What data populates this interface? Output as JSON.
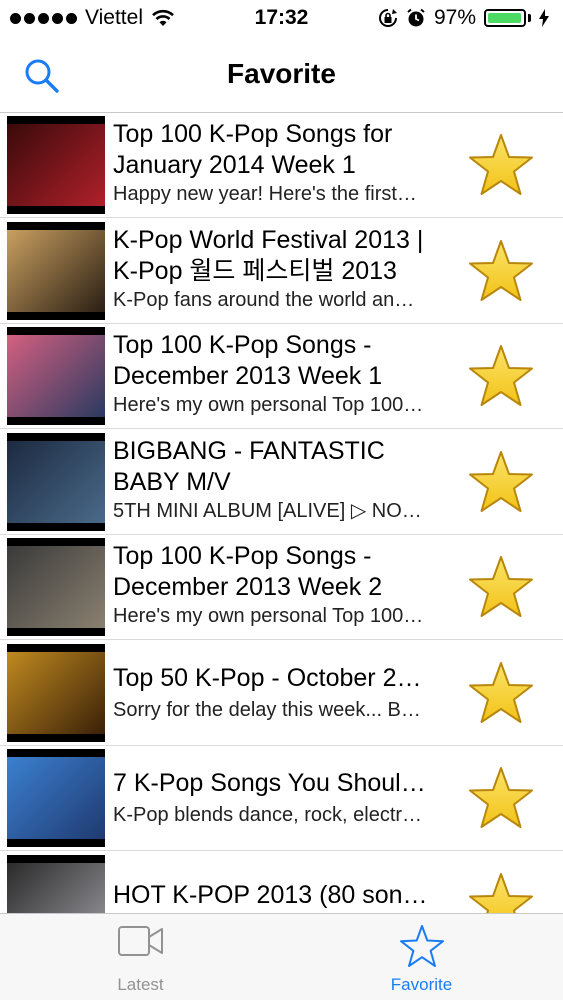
{
  "status": {
    "carrier": "Viettel",
    "time": "17:32",
    "battery": "97%",
    "battery_level": 0.97
  },
  "nav": {
    "title": "Favorite",
    "search_icon": "search-icon"
  },
  "colors": {
    "accent": "#1a7cf5",
    "inactive": "#929292",
    "battery": "#4cd964",
    "star_fill": "#f2c316",
    "star_stroke": "#b8860b"
  },
  "items": [
    {
      "title": "Top 100 K-Pop Songs for\nJanuary 2014 Week 1",
      "subtitle": "Happy new year! Here's the first…",
      "thumb_colors": [
        "#3a0a0a",
        "#b0202a"
      ]
    },
    {
      "title": "K-Pop World Festival 2013 |\nK-Pop 월드 페스티벌 2013",
      "subtitle": "K-Pop fans around the world an…",
      "thumb_colors": [
        "#c9a060",
        "#2a1e14"
      ]
    },
    {
      "title": "Top 100 K-Pop Songs -\nDecember 2013 Week 1",
      "subtitle": "Here's my own personal Top 100…",
      "thumb_colors": [
        "#d46080",
        "#2a3a60"
      ]
    },
    {
      "title": "BIGBANG - FANTASTIC\nBABY M/V",
      "subtitle": "5TH MINI ALBUM [ALIVE] ▷ NO…",
      "thumb_colors": [
        "#1c2a40",
        "#4a6a8a"
      ]
    },
    {
      "title": "Top 100 K-Pop Songs -\nDecember 2013 Week 2",
      "subtitle": "Here's my own personal Top 100…",
      "thumb_colors": [
        "#3a3a3a",
        "#8a8070"
      ]
    },
    {
      "title": "Top 50 K-Pop - October 2…",
      "subtitle": "Sorry for the delay this week... B…",
      "thumb_colors": [
        "#c08a20",
        "#3a2008"
      ]
    },
    {
      "title": "7 K-Pop Songs You Shoul…",
      "subtitle": "K-Pop blends dance, rock, electr…",
      "thumb_colors": [
        "#3a80d0",
        "#203a70"
      ]
    },
    {
      "title": "HOT K-POP 2013 (80 son…",
      "subtitle": "",
      "thumb_colors": [
        "#2a2a2a",
        "#9a9aa0"
      ]
    }
  ],
  "tabs": [
    {
      "label": "Latest",
      "icon": "video-camera-icon",
      "active": false
    },
    {
      "label": "Favorite",
      "icon": "star-outline-icon",
      "active": true
    }
  ]
}
